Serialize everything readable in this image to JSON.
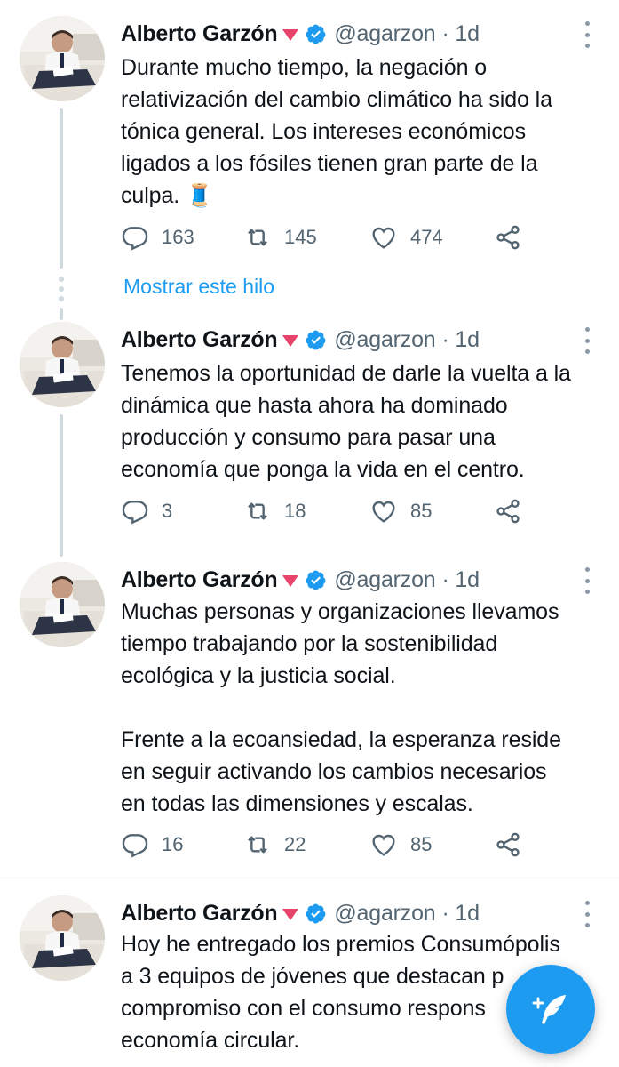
{
  "colors": {
    "accent": "#1d9bf0",
    "text": "#0f1419",
    "muted": "#536471",
    "badge": "#e8436a"
  },
  "tweets": [
    {
      "name": "Alberto Garzón",
      "handle": "@agarzon",
      "time": "· 1d",
      "text": "Durante mucho tiempo, la negación o\nrelativización del cambio climático ha sido la\ntónica general. Los intereses económicos\nligados a los fósiles tienen gran parte de la\nculpa. 🧵",
      "replies": "163",
      "retweets": "145",
      "likes": "474"
    },
    {
      "name": "Alberto Garzón",
      "handle": "@agarzon",
      "time": "· 1d",
      "text": "Tenemos la oportunidad de darle la vuelta a la\ndinámica que hasta ahora ha dominado\nproducción y consumo para pasar una\neconomía que ponga la vida en el centro.",
      "replies": "3",
      "retweets": "18",
      "likes": "85"
    },
    {
      "name": "Alberto Garzón",
      "handle": "@agarzon",
      "time": "· 1d",
      "text": "Muchas personas y organizaciones llevamos\ntiempo trabajando por la sostenibilidad\necológica y la justicia social.\n\nFrente a la ecoansiedad, la esperanza reside\nen seguir activando los cambios necesarios\nen todas las dimensiones y escalas.",
      "replies": "16",
      "retweets": "22",
      "likes": "85"
    },
    {
      "name": "Alberto Garzón",
      "handle": "@agarzon",
      "time": "· 1d",
      "text": "Hoy he entregado los premios Consumópolis\na 3 equipos de jóvenes que destacan p\ncompromiso con el consumo respons\neconomía circular."
    }
  ],
  "show_thread": "Mostrar este hilo",
  "icons": {
    "verified": "verified-badge-icon",
    "more": "more-icon",
    "reply": "reply-icon",
    "retweet": "retweet-icon",
    "like": "heart-icon",
    "share": "share-icon",
    "compose": "compose-tweet-icon"
  }
}
